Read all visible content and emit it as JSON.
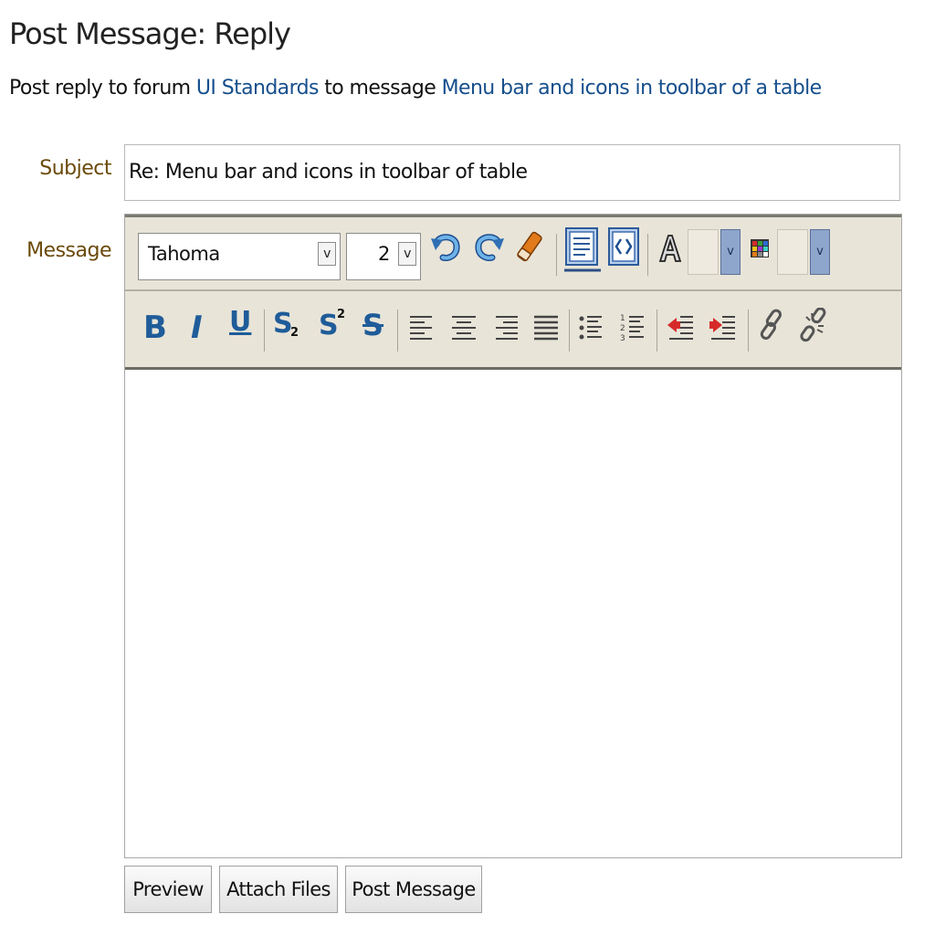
{
  "header": {
    "title": "Post Message: Reply",
    "subtitle_prefix": "Post reply to forum",
    "forum_link": "UI Standards",
    "subtitle_middle": "to message",
    "message_link": "Menu bar and icons in toolbar of a table"
  },
  "form": {
    "subject_label": "Subject",
    "subject_value": "Re: Menu bar and icons in toolbar of table",
    "message_label": "Message"
  },
  "toolbar": {
    "font_family": "Tahoma",
    "font_size": "2",
    "bold_label": "B",
    "italic_label": "I",
    "underline_label": "U",
    "subscript_label": "S",
    "subscript_mark": "2",
    "superscript_label": "S",
    "superscript_mark": "2",
    "strike_label": "S",
    "icons": [
      "undo-icon",
      "redo-icon",
      "eraser-icon",
      "rich-text-mode-icon",
      "html-source-icon",
      "text-color-icon",
      "background-color-icon",
      "align-left-icon",
      "align-center-icon",
      "align-right-icon",
      "justify-icon",
      "bullet-list-icon",
      "numbered-list-icon",
      "outdent-icon",
      "indent-icon",
      "link-icon",
      "unlink-icon"
    ]
  },
  "buttons": {
    "preview": "Preview",
    "attach_files": "Attach Files",
    "post_message": "Post Message"
  },
  "colors": {
    "link": "#164f8c",
    "label": "#6b4a0a",
    "toolbar_bg": "#e8e4d8",
    "icon_blue": "#1f5c99"
  }
}
